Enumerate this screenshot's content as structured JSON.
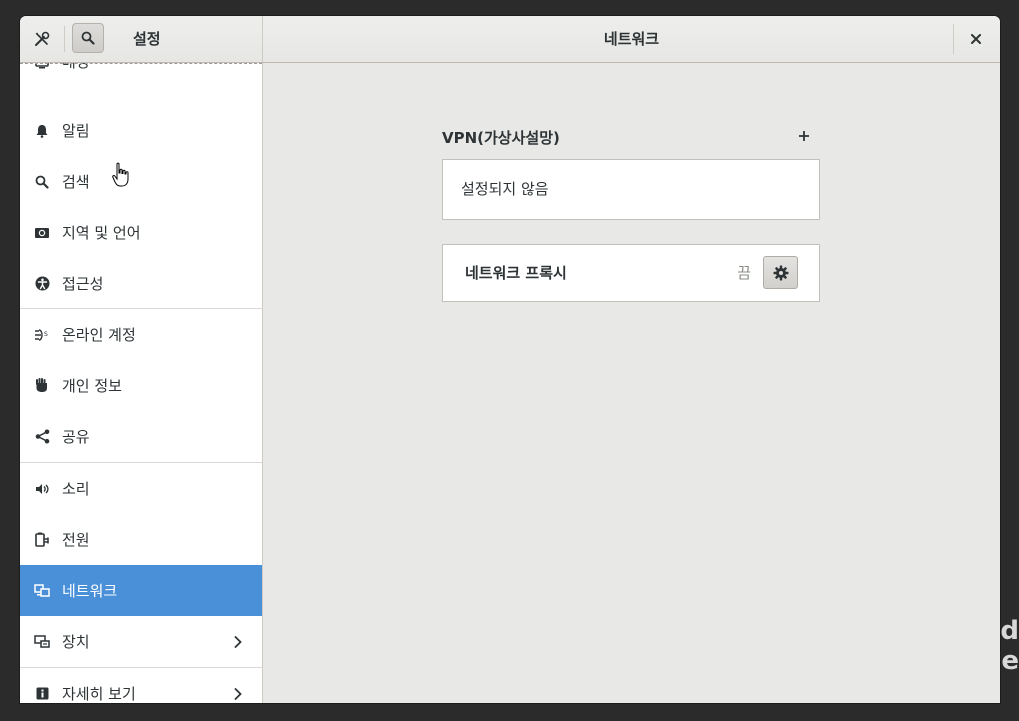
{
  "desktop": {
    "text_line1": "d",
    "text_line2": "e"
  },
  "header": {
    "settings_title": "설정",
    "page_title": "네트워크"
  },
  "sidebar": {
    "items": [
      {
        "label": "배경",
        "icon": "background-icon"
      },
      {
        "label": "알림",
        "icon": "bell-icon"
      },
      {
        "label": "검색",
        "icon": "search-icon"
      },
      {
        "label": "지역 및 언어",
        "icon": "region-flag-icon"
      },
      {
        "label": "접근성",
        "icon": "accessibility-icon"
      },
      {
        "label": "온라인 계정",
        "icon": "online-accounts-icon"
      },
      {
        "label": "개인 정보",
        "icon": "privacy-hand-icon"
      },
      {
        "label": "공유",
        "icon": "share-icon"
      },
      {
        "label": "소리",
        "icon": "speaker-icon"
      },
      {
        "label": "전원",
        "icon": "power-plug-icon"
      },
      {
        "label": "네트워크",
        "icon": "network-icon",
        "active": true
      },
      {
        "label": "장치",
        "icon": "devices-icon",
        "has_submenu": true
      },
      {
        "label": "자세히 보기",
        "icon": "info-icon",
        "has_submenu": true
      }
    ]
  },
  "network": {
    "vpn_title": "VPN(가상사설망)",
    "vpn_empty": "설정되지 않음",
    "proxy_label": "네트워크 프록시",
    "proxy_state": "끔"
  },
  "colors": {
    "accent": "#4a90d9",
    "window_bg": "#e8e8e7",
    "header_bg": "#eeeeec"
  }
}
